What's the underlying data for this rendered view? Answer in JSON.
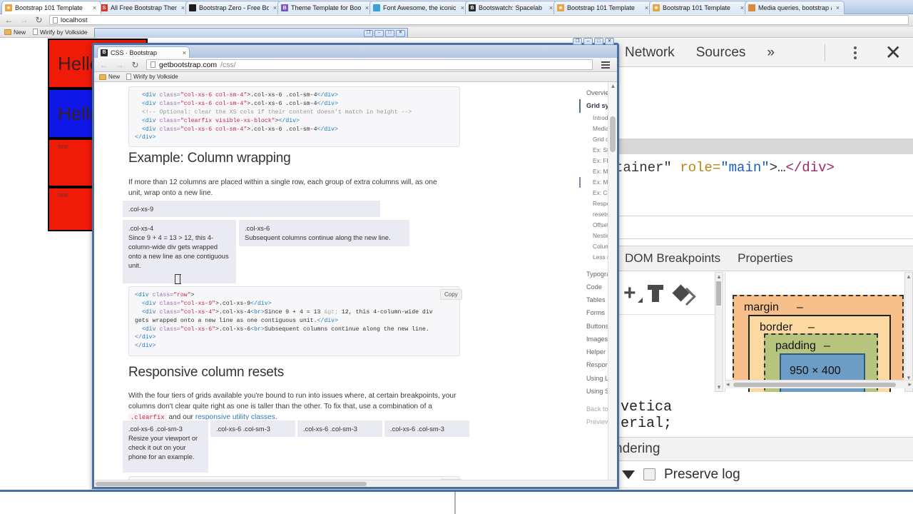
{
  "outer_browser": {
    "tabs": [
      {
        "title": "Bootstrap 101 Template",
        "favicon": "star-icon",
        "favicon_color": "#e8a33d",
        "active": true
      },
      {
        "title": "All Free Bootstrap Themes",
        "favicon": "s-letter-icon",
        "favicon_color": "#d9372b",
        "active": false
      },
      {
        "title": "Bootstrap Zero - Free Boots",
        "favicon": "circle-icon",
        "favicon_color": "#1d1d1d",
        "active": false
      },
      {
        "title": "Theme Template for Bootst",
        "favicon": "b-letter-icon",
        "favicon_color": "#7b57c8",
        "active": false
      },
      {
        "title": "Font Awesome, the iconic f",
        "favicon": "flag-icon",
        "favicon_color": "#3aa1d8",
        "active": false
      },
      {
        "title": "Bootswatch: Spacelab",
        "favicon": "b-letter-icon",
        "favicon_color": "#2b2b2b",
        "active": false
      },
      {
        "title": "Bootstrap 101 Template",
        "favicon": "star-icon",
        "favicon_color": "#e8a33d",
        "active": false
      },
      {
        "title": "Bootstrap 101 Template",
        "favicon": "star-icon",
        "favicon_color": "#e8a33d",
        "active": false
      },
      {
        "title": "Media queries, bootstrap an",
        "favicon": "person-icon",
        "favicon_color": "#d98a3d",
        "active": false
      }
    ],
    "close_glyph": "×",
    "nav": {
      "back": "←",
      "forward": "→",
      "reload": "↻"
    },
    "url": "localhost",
    "star": "☆",
    "bookmarks": [
      {
        "label": "New",
        "icon": "folder-icon"
      },
      {
        "label": "Wirify by Volkside",
        "icon": "doc-icon"
      }
    ],
    "window_controls": [
      "❐",
      "–",
      "□",
      "✕"
    ]
  },
  "background_page": {
    "blocks": [
      {
        "text": "Hello",
        "bg": "#f01a08",
        "size": "large"
      },
      {
        "text": "Hello",
        "bg": "#0f16e8",
        "size": "large"
      },
      {
        "text": "one",
        "bg": "#f01a08",
        "size": "small"
      },
      {
        "text": "one",
        "bg": "#f01a08",
        "size": "small"
      }
    ]
  },
  "devtools": {
    "tabs": [
      "Network",
      "Sources"
    ],
    "overflow_glyph": "»",
    "kebab_name": "more-options",
    "close_glyph": "✕",
    "dom_line": {
      "pre": "tainer\"",
      "attr": " role=",
      "val": "\"main\"",
      "mid": ">…",
      "tag": "</div>"
    },
    "sub_tabs": [
      "DOM Breakpoints",
      "Properties"
    ],
    "icons": [
      "add-icon",
      "pin-icon",
      "diamond-icon"
    ],
    "font_text": "vetica\nerial;",
    "box_model": {
      "margin_label": "margin",
      "margin_value": "–",
      "border_label": "border",
      "border_value": "–",
      "padding_label": "padding",
      "padding_value": "–",
      "content_size": "950 × 400",
      "margin_color": "#f7c08a",
      "border_color": "#fbd9a0",
      "padding_color": "#b7c47e",
      "content_color": "#6d9dc5"
    },
    "rendering_tab": "ndering",
    "preserve_log": "Preserve log",
    "preserve_log_checked": false
  },
  "inner_browser": {
    "tab": {
      "title": "CSS · Bootstrap",
      "favicon": "b-letter-icon",
      "close": "×"
    },
    "window_controls": [
      "❐",
      "–",
      "□",
      "✕"
    ],
    "nav": {
      "back": "←",
      "forward": "→",
      "reload": "↻"
    },
    "url_host": "getbootstrap.com",
    "url_path": "/css/",
    "menu_name": "chrome-menu-icon",
    "bookmarks": [
      {
        "label": "New",
        "icon": "folder-icon"
      },
      {
        "label": "Wirify by Volkside",
        "icon": "doc-icon"
      }
    ]
  },
  "page": {
    "code_top": [
      {
        "parts": [
          {
            "t": "  ",
            "c": "pl"
          },
          {
            "t": "<div ",
            "c": "tg"
          },
          {
            "t": "class=",
            "c": "at"
          },
          {
            "t": "\"col-xs-6 col-sm-4\"",
            "c": "st"
          },
          {
            "t": ">.col-xs-6 .col-sm-4",
            "c": "pl"
          },
          {
            "t": "</div>",
            "c": "tg"
          }
        ]
      },
      {
        "parts": [
          {
            "t": "  ",
            "c": "pl"
          },
          {
            "t": "<div ",
            "c": "tg"
          },
          {
            "t": "class=",
            "c": "at"
          },
          {
            "t": "\"col-xs-6 col-sm-4\"",
            "c": "st"
          },
          {
            "t": ">.col-xs-6 .col-sm-4",
            "c": "pl"
          },
          {
            "t": "</div>",
            "c": "tg"
          }
        ]
      },
      {
        "parts": [
          {
            "t": "  <!-- Optional: clear the XS cols if their content doesn't match in height -->",
            "c": "cm"
          }
        ]
      },
      {
        "parts": [
          {
            "t": "  ",
            "c": "pl"
          },
          {
            "t": "<div ",
            "c": "tg"
          },
          {
            "t": "class=",
            "c": "at"
          },
          {
            "t": "\"clearfix visible-xs-block\"",
            "c": "st"
          },
          {
            "t": ">",
            "c": "pl"
          },
          {
            "t": "</div>",
            "c": "tg"
          }
        ]
      },
      {
        "parts": [
          {
            "t": "  ",
            "c": "pl"
          },
          {
            "t": "<div ",
            "c": "tg"
          },
          {
            "t": "class=",
            "c": "at"
          },
          {
            "t": "\"col-xs-6 col-sm-4\"",
            "c": "st"
          },
          {
            "t": ">.col-xs-6 .col-sm-4",
            "c": "pl"
          },
          {
            "t": "</div>",
            "c": "tg"
          }
        ]
      },
      {
        "parts": [
          {
            "t": "</div>",
            "c": "tg"
          }
        ]
      }
    ],
    "section1": {
      "heading": "Example: Column wrapping",
      "paragraph": "If more than 12 columns are placed within a single row, each group of extra columns will, as one unit, wrap onto a new line.",
      "cols": [
        {
          "label": ".col-xs-9",
          "body": ""
        },
        {
          "label": ".col-xs-4",
          "body": "Since 9 + 4 = 13 > 12, this 4-column-wide div gets wrapped onto a new line as one contiguous unit."
        },
        {
          "label": ".col-xs-6",
          "body": "Subsequent columns continue along the new line."
        }
      ]
    },
    "code_mid": [
      {
        "parts": [
          {
            "t": "<div ",
            "c": "tg"
          },
          {
            "t": "class=",
            "c": "at"
          },
          {
            "t": "\"row\"",
            "c": "st"
          },
          {
            "t": ">",
            "c": "pl"
          }
        ]
      },
      {
        "parts": [
          {
            "t": "  ",
            "c": "pl"
          },
          {
            "t": "<div ",
            "c": "tg"
          },
          {
            "t": "class=",
            "c": "at"
          },
          {
            "t": "\"col-xs-9\"",
            "c": "st"
          },
          {
            "t": ">.col-xs-9",
            "c": "pl"
          },
          {
            "t": "</div>",
            "c": "tg"
          }
        ]
      },
      {
        "parts": [
          {
            "t": "  ",
            "c": "pl"
          },
          {
            "t": "<div ",
            "c": "tg"
          },
          {
            "t": "class=",
            "c": "at"
          },
          {
            "t": "\"col-xs-4\"",
            "c": "st"
          },
          {
            "t": ">.col-xs-4",
            "c": "pl"
          },
          {
            "t": "<br>",
            "c": "tg"
          },
          {
            "t": "Since 9 + 4 = 13 ",
            "c": "pl"
          },
          {
            "t": "&gt;",
            "c": "ent"
          },
          {
            "t": " 12, this 4-column-wide div",
            "c": "pl"
          }
        ]
      },
      {
        "parts": [
          {
            "t": "gets wrapped onto a new line as one contiguous unit.",
            "c": "pl"
          },
          {
            "t": "</div>",
            "c": "tg"
          }
        ]
      },
      {
        "parts": [
          {
            "t": "  ",
            "c": "pl"
          },
          {
            "t": "<div ",
            "c": "tg"
          },
          {
            "t": "class=",
            "c": "at"
          },
          {
            "t": "\"col-xs-6\"",
            "c": "st"
          },
          {
            "t": ">.col-xs-6",
            "c": "pl"
          },
          {
            "t": "<br>",
            "c": "tg"
          },
          {
            "t": "Subsequent columns continue along the new line.",
            "c": "pl"
          }
        ]
      },
      {
        "parts": [
          {
            "t": "</div>",
            "c": "tg"
          }
        ]
      },
      {
        "parts": [
          {
            "t": "</div>",
            "c": "tg"
          }
        ]
      }
    ],
    "copy_label": "Copy",
    "section2": {
      "heading": "Responsive column resets",
      "p_part1": "With the four tiers of grids available you're bound to run into issues where, at certain breakpoints, your columns don't clear quite right as one is taller than the other. To fix that, use a combination of a ",
      "p_code": ".clearfix",
      "p_part2": " and our ",
      "p_link": "responsive utility classes",
      "p_part3": ".",
      "cols": [
        {
          "label": ".col-xs-6 .col-sm-3",
          "body": "Resize your viewport or check it out on your phone for an example."
        },
        {
          "label": ".col-xs-6 .col-sm-3",
          "body": ""
        },
        {
          "label": ".col-xs-6 .col-sm-3",
          "body": ""
        },
        {
          "label": ".col-xs-6 .col-sm-3",
          "body": ""
        }
      ]
    },
    "nav_items": [
      {
        "label": "Overview",
        "level": "top"
      },
      {
        "label": "Grid system",
        "level": "top",
        "state": "active"
      },
      {
        "label": "Introduction",
        "level": "sub"
      },
      {
        "label": "Media queries",
        "level": "sub"
      },
      {
        "label": "Grid options",
        "level": "sub"
      },
      {
        "label": "Ex: Stacked-to-horizontal",
        "level": "sub"
      },
      {
        "label": "Ex: Fluid container",
        "level": "sub"
      },
      {
        "label": "Ex: Mobile and desktop",
        "level": "sub"
      },
      {
        "label": "Ex: Mobile, tablet, desktop",
        "level": "sub",
        "state": "marked"
      },
      {
        "label": "Ex: Column wrapping",
        "level": "sub"
      },
      {
        "label": "Responsive column",
        "level": "sub"
      },
      {
        "label": "resets",
        "level": "sub"
      },
      {
        "label": "Offsetting columns",
        "level": "sub"
      },
      {
        "label": "Nesting columns",
        "level": "sub"
      },
      {
        "label": "Column ordering",
        "level": "sub"
      },
      {
        "label": "Less mixins and variables",
        "level": "sub"
      },
      {
        "label": "Typography",
        "level": "top"
      },
      {
        "label": "Code",
        "level": "top"
      },
      {
        "label": "Tables",
        "level": "top"
      },
      {
        "label": "Forms",
        "level": "top"
      },
      {
        "label": "Buttons",
        "level": "top"
      },
      {
        "label": "Images",
        "level": "top"
      },
      {
        "label": "Helper classes",
        "level": "top"
      },
      {
        "label": "Responsive utilities",
        "level": "top"
      },
      {
        "label": "Using Less",
        "level": "top"
      },
      {
        "label": "Using Sass",
        "level": "top"
      },
      {
        "label": "Back to top",
        "level": "top",
        "state": "dim"
      },
      {
        "label": "Preview theme",
        "level": "top",
        "state": "dim"
      }
    ]
  }
}
